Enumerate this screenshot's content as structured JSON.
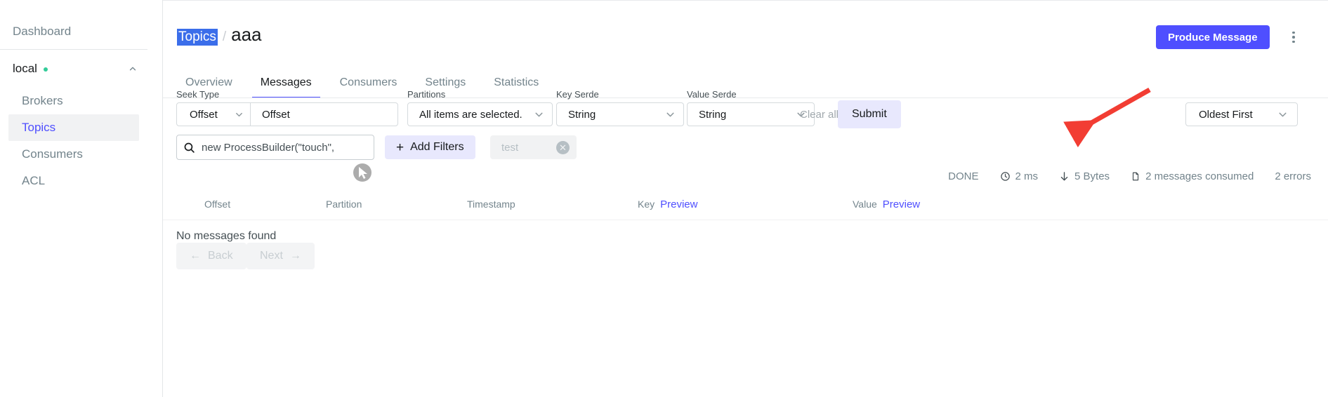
{
  "sidebar": {
    "dashboard_label": "Dashboard",
    "cluster": {
      "name": "local",
      "status_color": "#33CC99"
    },
    "items": [
      {
        "label": "Brokers",
        "active": false
      },
      {
        "label": "Topics",
        "active": true
      },
      {
        "label": "Consumers",
        "active": false
      },
      {
        "label": "ACL",
        "active": false
      }
    ]
  },
  "header": {
    "breadcrumb_parent": "Topics",
    "breadcrumb_separator": "/",
    "page_title": "aaa",
    "produce_button": "Produce Message",
    "accent_color": "#4F4FFF"
  },
  "tabs": [
    {
      "label": "Overview",
      "active": false
    },
    {
      "label": "Messages",
      "active": true
    },
    {
      "label": "Consumers",
      "active": false
    },
    {
      "label": "Settings",
      "active": false
    },
    {
      "label": "Statistics",
      "active": false
    }
  ],
  "filters": {
    "seek_type_label": "Seek Type",
    "seek_type_value": "Offset",
    "seek_value_placeholder": "Offset",
    "seek_value_text": "Offset",
    "partitions_label": "Partitions",
    "partitions_value": "All items are selected.",
    "key_serde_label": "Key Serde",
    "key_serde_value": "String",
    "value_serde_label": "Value Serde",
    "value_serde_value": "String",
    "clear_all_label": "Clear all",
    "submit_label": "Submit",
    "sort_value": "Oldest First",
    "search_value": "new ProcessBuilder(\"touch\",",
    "add_filters_label": "Add Filters",
    "add_filters_plus": "+",
    "saved_filter_chip": "test"
  },
  "status": {
    "state": "DONE",
    "elapsed": "2 ms",
    "bytes": "5 Bytes",
    "messages": "2 messages consumed",
    "errors": "2 errors"
  },
  "table": {
    "columns": {
      "offset": "Offset",
      "partition": "Partition",
      "timestamp": "Timestamp",
      "key": "Key",
      "key_preview": "Preview",
      "value": "Value",
      "value_preview": "Preview"
    },
    "empty_message": "No messages found"
  },
  "pagination": {
    "back_label": "Back",
    "back_arrow": "←",
    "next_label": "Next",
    "next_arrow": "→"
  },
  "annotation": {
    "arrow_color": "#F23D33",
    "points_at": "Submit"
  }
}
